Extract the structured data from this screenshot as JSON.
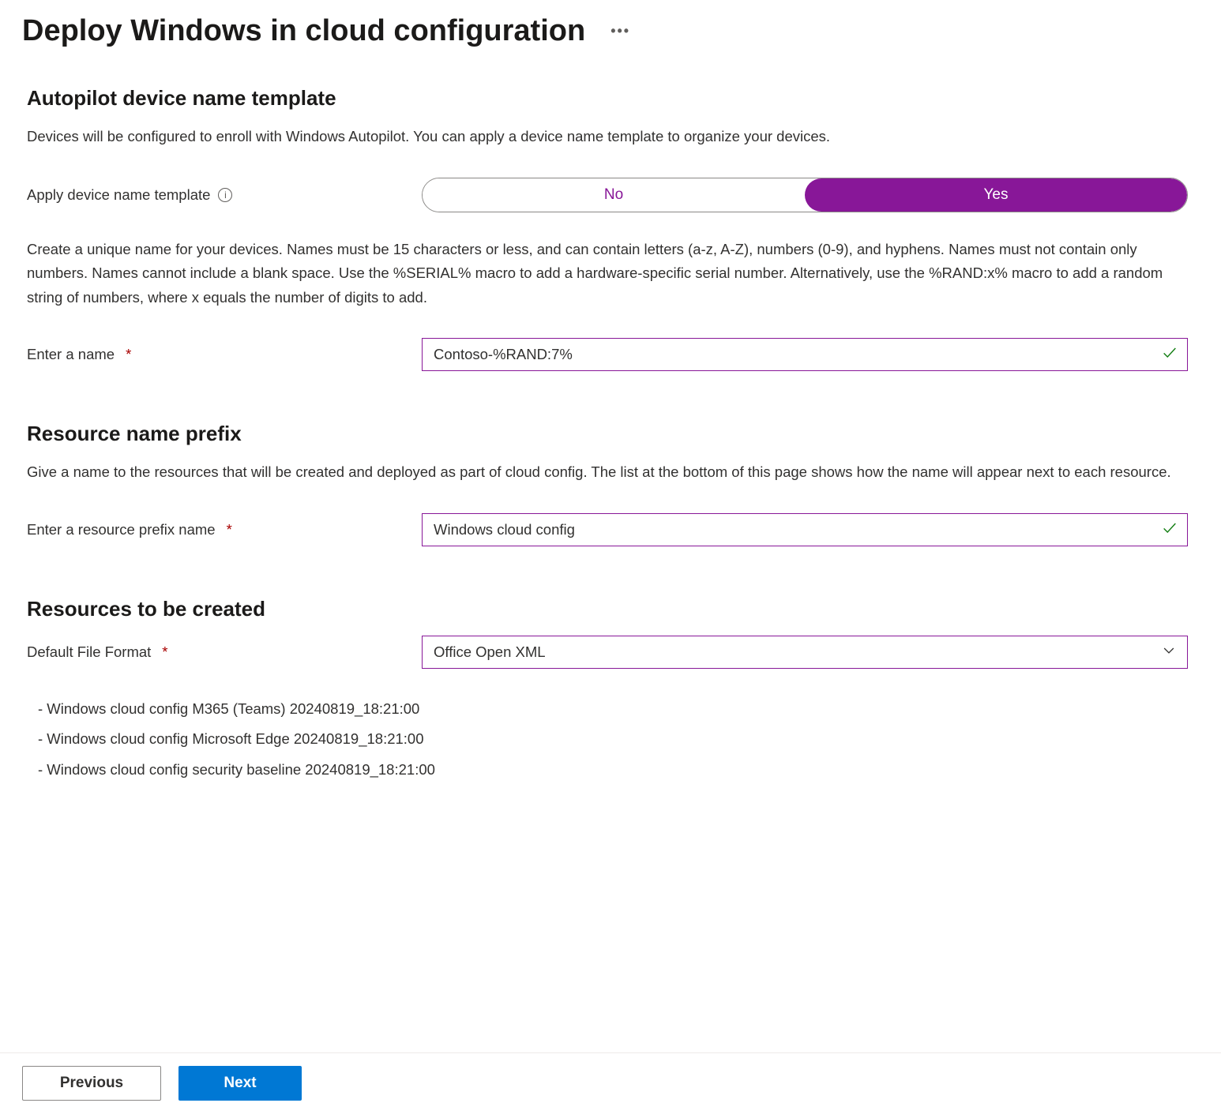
{
  "page": {
    "title": "Deploy Windows in cloud configuration"
  },
  "autopilot": {
    "heading": "Autopilot device name template",
    "description": "Devices will be configured to enroll with Windows Autopilot. You can apply a device name template to organize your devices.",
    "apply_label": "Apply device name template",
    "toggle": {
      "no": "No",
      "yes": "Yes",
      "selected": "yes"
    },
    "naming_rules": "Create a unique name for your devices. Names must be 15 characters or less, and can contain letters (a-z, A-Z), numbers (0-9), and hyphens. Names must not contain only numbers. Names cannot include a blank space. Use the %SERIAL% macro to add a hardware-specific serial number. Alternatively, use the %RAND:x% macro to add a random string of numbers, where x equals the number of digits to add.",
    "name_label": "Enter a name",
    "name_value": "Contoso-%RAND:7%"
  },
  "prefix": {
    "heading": "Resource name prefix",
    "description": "Give a name to the resources that will be created and deployed as part of cloud config. The list at the bottom of this page shows how the name will appear next to each resource.",
    "label": "Enter a resource prefix name",
    "value": "Windows cloud config"
  },
  "resources": {
    "heading": "Resources to be created",
    "file_format_label": "Default File Format",
    "file_format_value": "Office Open XML",
    "items": [
      "- Windows cloud config M365 (Teams) 20240819_18:21:00",
      "- Windows cloud config Microsoft Edge 20240819_18:21:00",
      "- Windows cloud config security baseline 20240819_18:21:00"
    ]
  },
  "footer": {
    "previous": "Previous",
    "next": "Next"
  }
}
